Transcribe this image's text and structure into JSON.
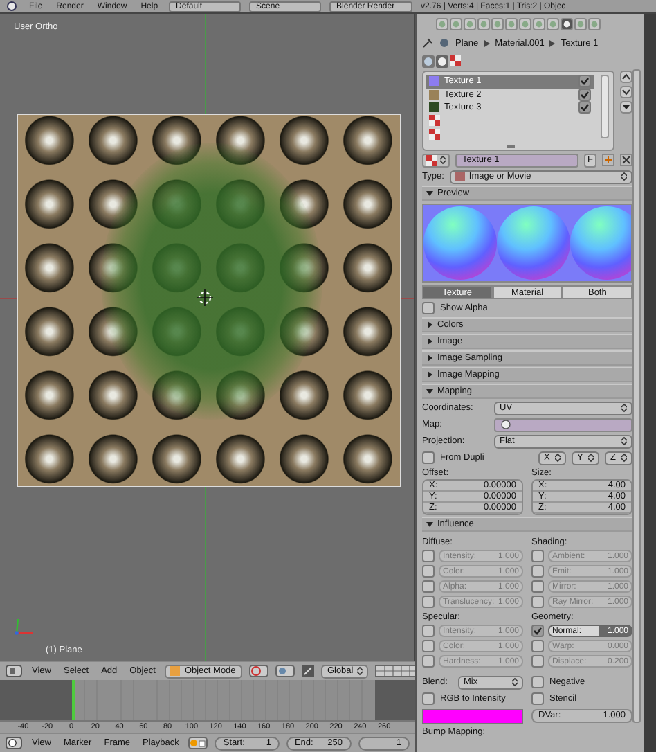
{
  "top_bar": {
    "menus": [
      "File",
      "Render",
      "Window",
      "Help"
    ],
    "layout": "Default",
    "scene": "Scene",
    "engine": "Blender Render",
    "stats": "v2.76 | Verts:4 | Faces:1 | Tris:2 | Objec"
  },
  "viewport": {
    "view_label": "User Ortho",
    "object_label": "(1) Plane"
  },
  "viewport_header": {
    "menus": [
      "View",
      "Select",
      "Add",
      "Object"
    ],
    "mode": "Object Mode",
    "orientation": "Global"
  },
  "timeline": {
    "ticks": [
      "-40",
      "-20",
      "0",
      "20",
      "40",
      "60",
      "80",
      "100",
      "120",
      "140",
      "160",
      "180",
      "200",
      "220",
      "240",
      "260"
    ],
    "menus": [
      "View",
      "Marker",
      "Frame",
      "Playback"
    ],
    "start_label": "Start:",
    "start": "1",
    "end_label": "End:",
    "end": "250",
    "current": "1"
  },
  "properties": {
    "breadcrumb": [
      "Plane",
      "Material.001",
      "Texture 1"
    ],
    "slots": [
      {
        "kind": "texture",
        "name": "Texture 1",
        "selected": true,
        "checked": true,
        "color": "#8c7cf0"
      },
      {
        "kind": "texture",
        "name": "Texture 2",
        "selected": false,
        "checked": true,
        "color": "#9a8258"
      },
      {
        "kind": "texture",
        "name": "Texture 3",
        "selected": false,
        "checked": true,
        "color": "#2e4a22"
      },
      {
        "kind": "empty",
        "selected": false
      },
      {
        "kind": "empty",
        "selected": false
      }
    ],
    "texture_name": "Texture 1",
    "fake_user": "F",
    "type_label": "Type:",
    "type": "Image or Movie",
    "preview": {
      "title": "Preview",
      "expanded": true,
      "tabs": [
        {
          "label": "Texture",
          "selected": true
        },
        {
          "label": "Material",
          "selected": false
        },
        {
          "label": "Both",
          "selected": false
        }
      ],
      "show_alpha": {
        "label": "Show Alpha",
        "checked": false
      }
    },
    "collapsed_panels": [
      {
        "title": "Colors",
        "expanded": false
      },
      {
        "title": "Image",
        "expanded": false
      },
      {
        "title": "Image Sampling",
        "expanded": false
      },
      {
        "title": "Image Mapping",
        "expanded": false
      }
    ],
    "mapping": {
      "title": "Mapping",
      "expanded": true,
      "coordinates_label": "Coordinates:",
      "coordinates": "UV",
      "map_label": "Map:",
      "projection_label": "Projection:",
      "projection": "Flat",
      "from_dupli": {
        "label": "From Dupli",
        "checked": false
      },
      "axes": [
        "X",
        "Y",
        "Z"
      ],
      "offset_label": "Offset:",
      "offset": [
        {
          "axis": "X:",
          "value": "0.00000"
        },
        {
          "axis": "Y:",
          "value": "0.00000"
        },
        {
          "axis": "Z:",
          "value": "0.00000"
        }
      ],
      "size_label": "Size:",
      "size": [
        {
          "axis": "X:",
          "value": "4.00"
        },
        {
          "axis": "Y:",
          "value": "4.00"
        },
        {
          "axis": "Z:",
          "value": "4.00"
        }
      ]
    },
    "influence": {
      "title": "Influence",
      "expanded": true,
      "groups": [
        {
          "title": "Diffuse:",
          "items": [
            {
              "label": "Intensity:",
              "value": "1.000",
              "checked": false
            },
            {
              "label": "Color:",
              "value": "1.000",
              "checked": false
            },
            {
              "label": "Alpha:",
              "value": "1.000",
              "checked": false
            },
            {
              "label": "Translucency:",
              "value": "1.000",
              "checked": false
            }
          ]
        },
        {
          "title": "Shading:",
          "items": [
            {
              "label": "Ambient:",
              "value": "1.000",
              "checked": false
            },
            {
              "label": "Emit:",
              "value": "1.000",
              "checked": false
            },
            {
              "label": "Mirror:",
              "value": "1.000",
              "checked": false
            },
            {
              "label": "Ray Mirror:",
              "value": "1.000",
              "checked": false
            }
          ]
        },
        {
          "title": "Specular:",
          "items": [
            {
              "label": "Intensity:",
              "value": "1.000",
              "checked": false
            },
            {
              "label": "Color:",
              "value": "1.000",
              "checked": false
            },
            {
              "label": "Hardness:",
              "value": "1.000",
              "checked": false
            }
          ]
        },
        {
          "title": "Geometry:",
          "items": [
            {
              "label": "Normal:",
              "value": "1.000",
              "checked": true
            },
            {
              "label": "Warp:",
              "value": "0.000",
              "checked": false
            },
            {
              "label": "Displace:",
              "value": "0.200",
              "checked": false
            }
          ]
        }
      ],
      "blend_label": "Blend:",
      "blend": "Mix",
      "negative": {
        "label": "Negative",
        "checked": false
      },
      "rgb_to_intensity": {
        "label": "RGB to Intensity",
        "checked": false
      },
      "stencil": {
        "label": "Stencil",
        "checked": false
      },
      "color": "#ff00ff",
      "dvar_label": "DVar:",
      "dvar": "1.000",
      "bump_label": "Bump Mapping:"
    }
  }
}
